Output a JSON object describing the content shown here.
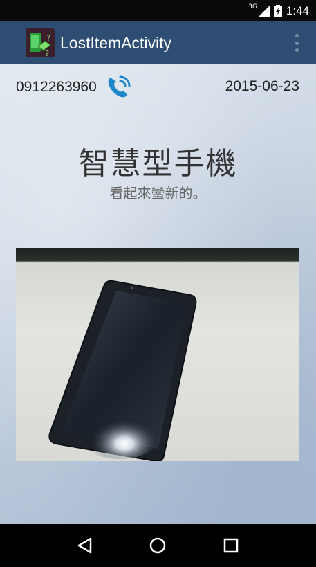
{
  "status_bar": {
    "network": "3G",
    "time": "1:44"
  },
  "action_bar": {
    "title": "LostItemActivity"
  },
  "item": {
    "phone": "0912263960",
    "date": "2015-06-23",
    "title": "智慧型手機",
    "description": "看起來蠻新的。"
  },
  "icons": {
    "app": "app-icon",
    "call": "phone-icon",
    "back": "back-icon",
    "home": "home-icon",
    "recents": "recents-icon",
    "menu": "overflow-menu-icon"
  },
  "colors": {
    "action_bar": "#2d4e72",
    "call_icon": "#1f88c9"
  }
}
